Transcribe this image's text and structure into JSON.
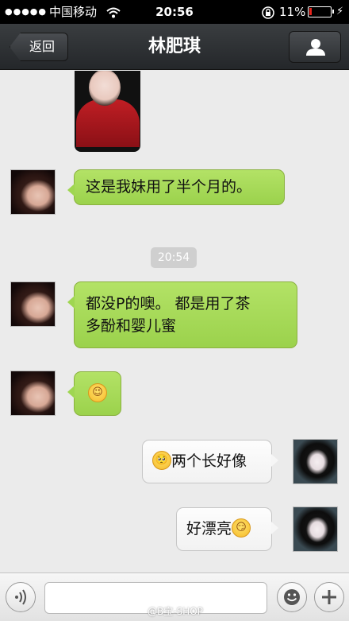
{
  "status_bar": {
    "signal": "●●●●●",
    "carrier": "中国移动",
    "wifi_icon": "wifi-icon",
    "time": "20:56",
    "lock_icon": "rotation-lock-icon",
    "battery_percent": "11%",
    "battery_level": 0.11,
    "battery_color": "#e8241c"
  },
  "nav": {
    "back_label": "返回",
    "title": "林肥琪",
    "profile_icon": "person-icon"
  },
  "messages": [
    {
      "side": "left",
      "type": "image"
    },
    {
      "side": "left",
      "type": "text",
      "text": "这是我妹用了半个月的。"
    },
    {
      "type": "timestamp",
      "text": "20:54"
    },
    {
      "side": "left",
      "type": "text",
      "line1": "都没P的噢。 都是用了茶",
      "line2": "多酚和婴儿蜜"
    },
    {
      "side": "left",
      "type": "emoji",
      "emoji": "wink"
    },
    {
      "side": "right",
      "type": "text",
      "text": "两个长好像",
      "emoji": "pleading"
    },
    {
      "side": "right",
      "type": "text",
      "text": "好漂亮",
      "emoji": "smirk"
    }
  ],
  "input_bar": {
    "voice_icon": "voice-icon",
    "text_value": "",
    "emoji_icon": "emoji-face-icon",
    "add_icon": "plus-icon"
  },
  "watermark": "@B宝-SHOP",
  "colors": {
    "incoming_bubble": "#9bd24c",
    "outgoing_bubble": "#f6f6f6",
    "background": "#ebebeb"
  }
}
